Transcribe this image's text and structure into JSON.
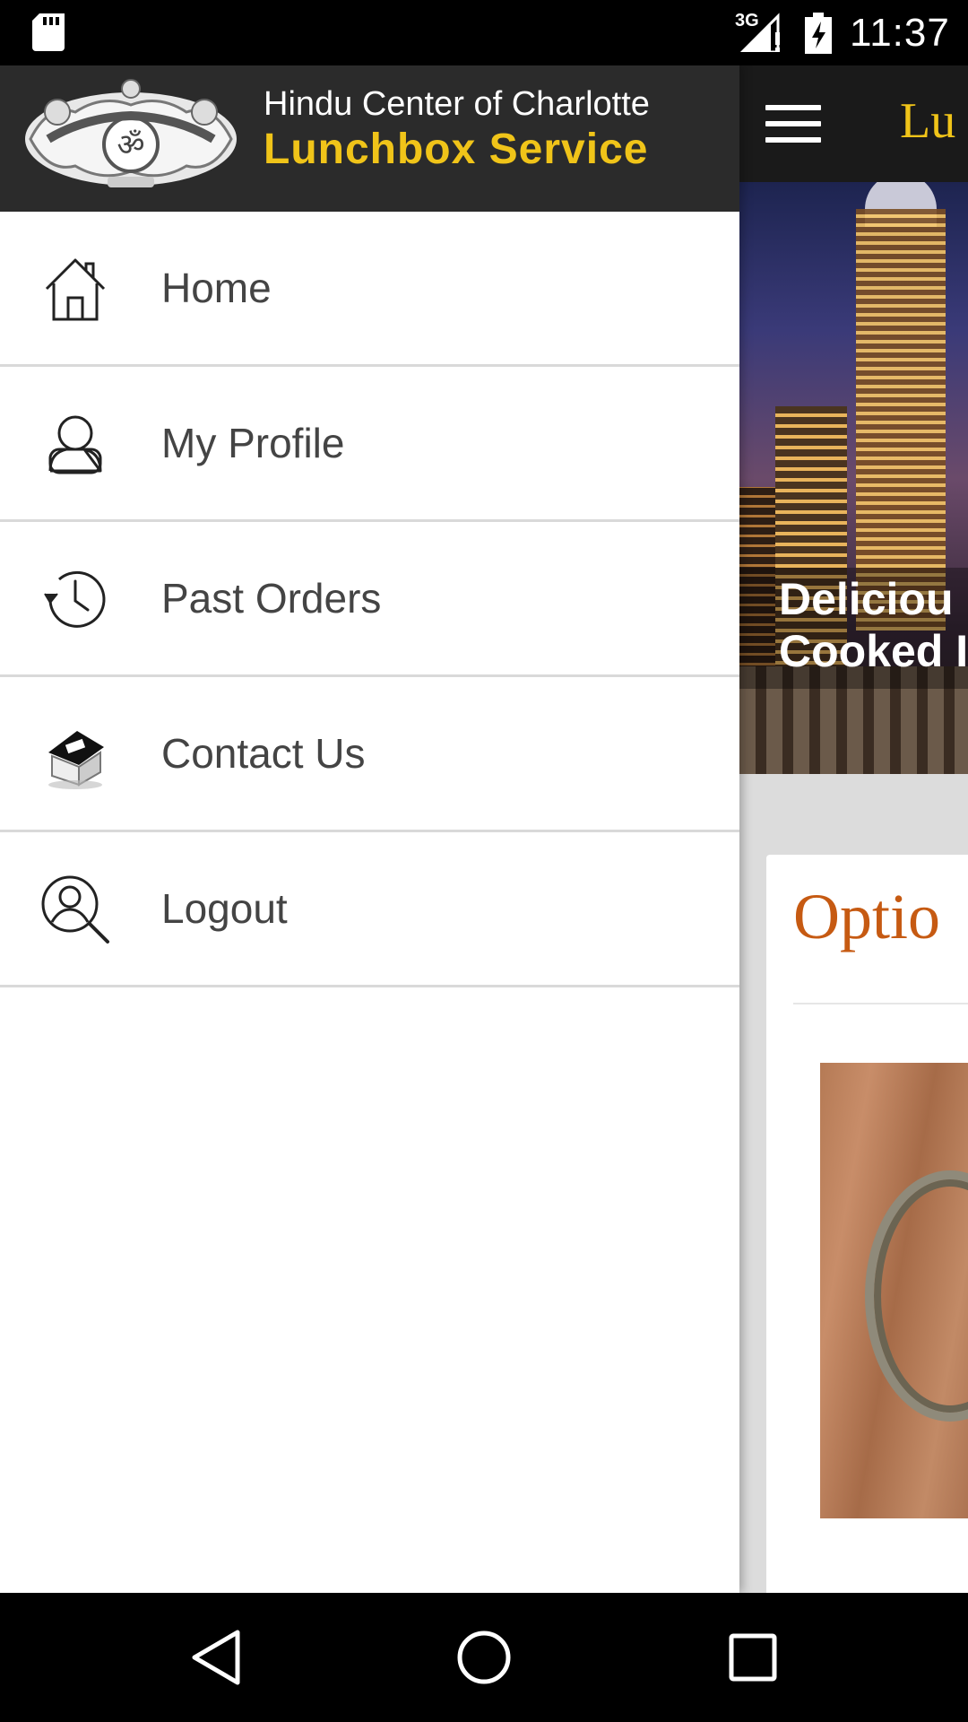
{
  "status_bar": {
    "network_label": "3G",
    "time": "11:37",
    "icons": [
      "sd-card-icon",
      "signal-icon",
      "battery-charging-icon"
    ]
  },
  "app": {
    "toolbar_title": "Lunchbox Service",
    "toolbar_title_visible": "Lu",
    "hero_caption_line1": "Deliciou",
    "hero_caption_line2": "Cooked I",
    "options_title": "Optio"
  },
  "drawer": {
    "org_name": "Hindu Center of Charlotte",
    "app_name": "Lunchbox Service",
    "logo_icon": "hindu-center-logo-icon",
    "items": [
      {
        "label": "Home",
        "icon": "home-icon"
      },
      {
        "label": "My Profile",
        "icon": "user-icon"
      },
      {
        "label": "Past Orders",
        "icon": "history-clock-icon"
      },
      {
        "label": "Contact Us",
        "icon": "contact-house-icon"
      },
      {
        "label": "Logout",
        "icon": "user-search-icon"
      }
    ]
  },
  "nav_bar": {
    "buttons": [
      "back-icon",
      "home-circle-icon",
      "recents-square-icon"
    ]
  },
  "colors": {
    "accent_gold": "#f0c419",
    "header_dark": "#2b2b2b",
    "options_orange": "#c65a12",
    "menu_text": "#444444",
    "divider": "#d9d9d9"
  }
}
